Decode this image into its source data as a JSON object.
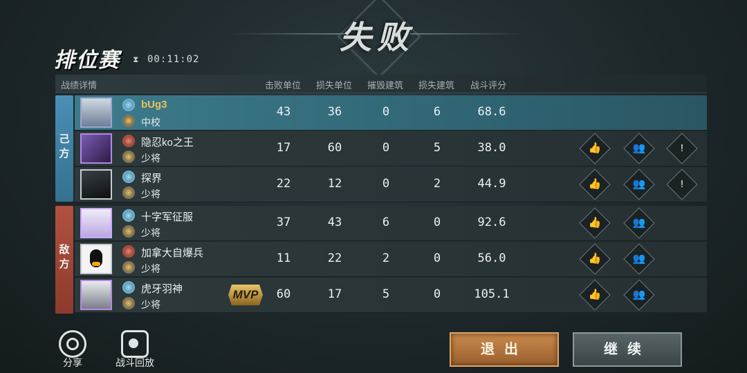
{
  "header": {
    "result": "失败",
    "mode": "排位赛",
    "timer_icon": "hourglass-icon",
    "timer": "00:11:02"
  },
  "table": {
    "columns": [
      "战绩详情",
      "击败单位",
      "损失单位",
      "摧毁建筑",
      "损失建筑",
      "战斗评分"
    ]
  },
  "sides": {
    "ally": "己方",
    "enemy": "敌方"
  },
  "rows": [
    {
      "name": "bUg3",
      "rank": "中校",
      "kills": "43",
      "losses": "36",
      "destroyed": "0",
      "lost": "6",
      "score": "68.6"
    },
    {
      "name": "隐忍ko之王",
      "rank": "少将",
      "kills": "17",
      "losses": "60",
      "destroyed": "0",
      "lost": "5",
      "score": "38.0"
    },
    {
      "name": "探界",
      "rank": "少将",
      "kills": "22",
      "losses": "12",
      "destroyed": "0",
      "lost": "2",
      "score": "44.9"
    },
    {
      "name": "十字军征服",
      "rank": "少将",
      "kills": "37",
      "losses": "43",
      "destroyed": "6",
      "lost": "0",
      "score": "92.6"
    },
    {
      "name": "加拿大自爆兵",
      "rank": "少将",
      "kills": "11",
      "losses": "22",
      "destroyed": "2",
      "lost": "0",
      "score": "56.0"
    },
    {
      "name": "虎牙羽神",
      "rank": "少将",
      "kills": "60",
      "losses": "17",
      "destroyed": "5",
      "lost": "0",
      "score": "105.1",
      "badge": "MVP"
    }
  ],
  "buttons": {
    "share": "分享",
    "replay": "战斗回放",
    "exit": "退出",
    "continue": "继续"
  }
}
